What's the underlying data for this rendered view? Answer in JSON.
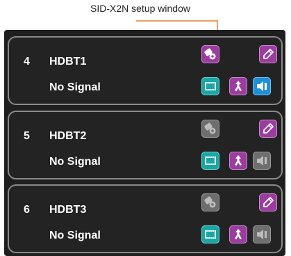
{
  "callout": {
    "label": "SID-X2N setup window"
  },
  "rows": [
    {
      "number": "4",
      "name": "HDBT1",
      "signal": "No Signal",
      "sid_active": true,
      "audio_active": true
    },
    {
      "number": "5",
      "name": "HDBT2",
      "signal": "No Signal",
      "sid_active": false,
      "audio_active": false
    },
    {
      "number": "6",
      "name": "HDBT3",
      "signal": "No Signal",
      "sid_active": false,
      "audio_active": false
    }
  ],
  "icons": {
    "sid": "sid-settings-icon",
    "edit": "edit-pencil-icon",
    "video": "video-film-icon",
    "audio_routing": "audio-route-icon",
    "speaker": "speaker-icon"
  },
  "colors": {
    "purple": "#9b3d9f",
    "teal": "#1aa6a4",
    "blue": "#1f8fd8",
    "inactive_grey": "#6e6e6e",
    "callout_line": "#e8a060"
  }
}
